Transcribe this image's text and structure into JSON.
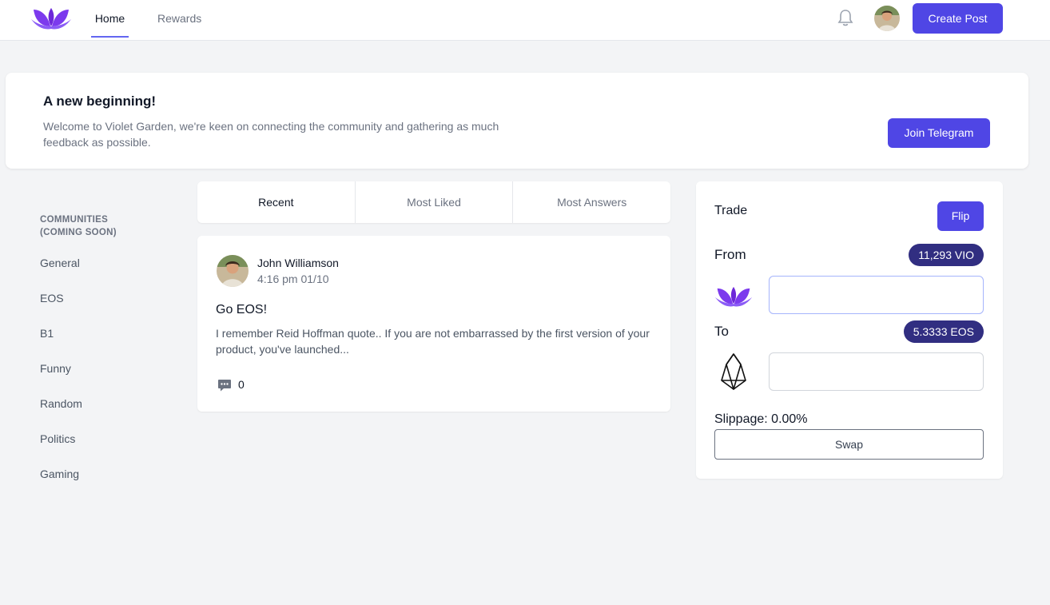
{
  "header": {
    "logo_icon": "violet-garden-logo-icon",
    "nav": [
      {
        "label": "Home",
        "active": true
      },
      {
        "label": "Rewards",
        "active": false
      }
    ],
    "bell_icon": "bell-icon",
    "create_post_label": "Create Post",
    "accent_color": "#4f46e5"
  },
  "banner": {
    "title": "A new beginning!",
    "text": "Welcome to Violet Garden, we're keen on connecting the community and gathering as much feedback as possible.",
    "button_label": "Join Telegram"
  },
  "sidebar": {
    "title": "COMMUNITIES (COMING SOON)",
    "items": [
      "General",
      "EOS",
      "B1",
      "Funny",
      "Random",
      "Politics",
      "Gaming"
    ]
  },
  "feed": {
    "tabs": [
      {
        "label": "Recent",
        "active": true
      },
      {
        "label": "Most Liked",
        "active": false
      },
      {
        "label": "Most Answers",
        "active": false
      }
    ],
    "posts": [
      {
        "author": "John Williamson",
        "time": "4:16 pm 01/10",
        "title": "Go EOS!",
        "body": "I remember Reid Hoffman quote.. If you are not embarrassed by the first version of your product, you've launched...",
        "comments": "0"
      }
    ]
  },
  "trade": {
    "title": "Trade",
    "flip_label": "Flip",
    "from_label": "From",
    "from_balance": "11,293 VIO",
    "from_token_icon": "violet-garden-logo-icon",
    "from_value": "",
    "to_label": "To",
    "to_balance": "5.3333 EOS",
    "to_token_icon": "eos-logo-icon",
    "to_value": "",
    "slippage": "Slippage: 0.00%",
    "swap_label": "Swap"
  }
}
